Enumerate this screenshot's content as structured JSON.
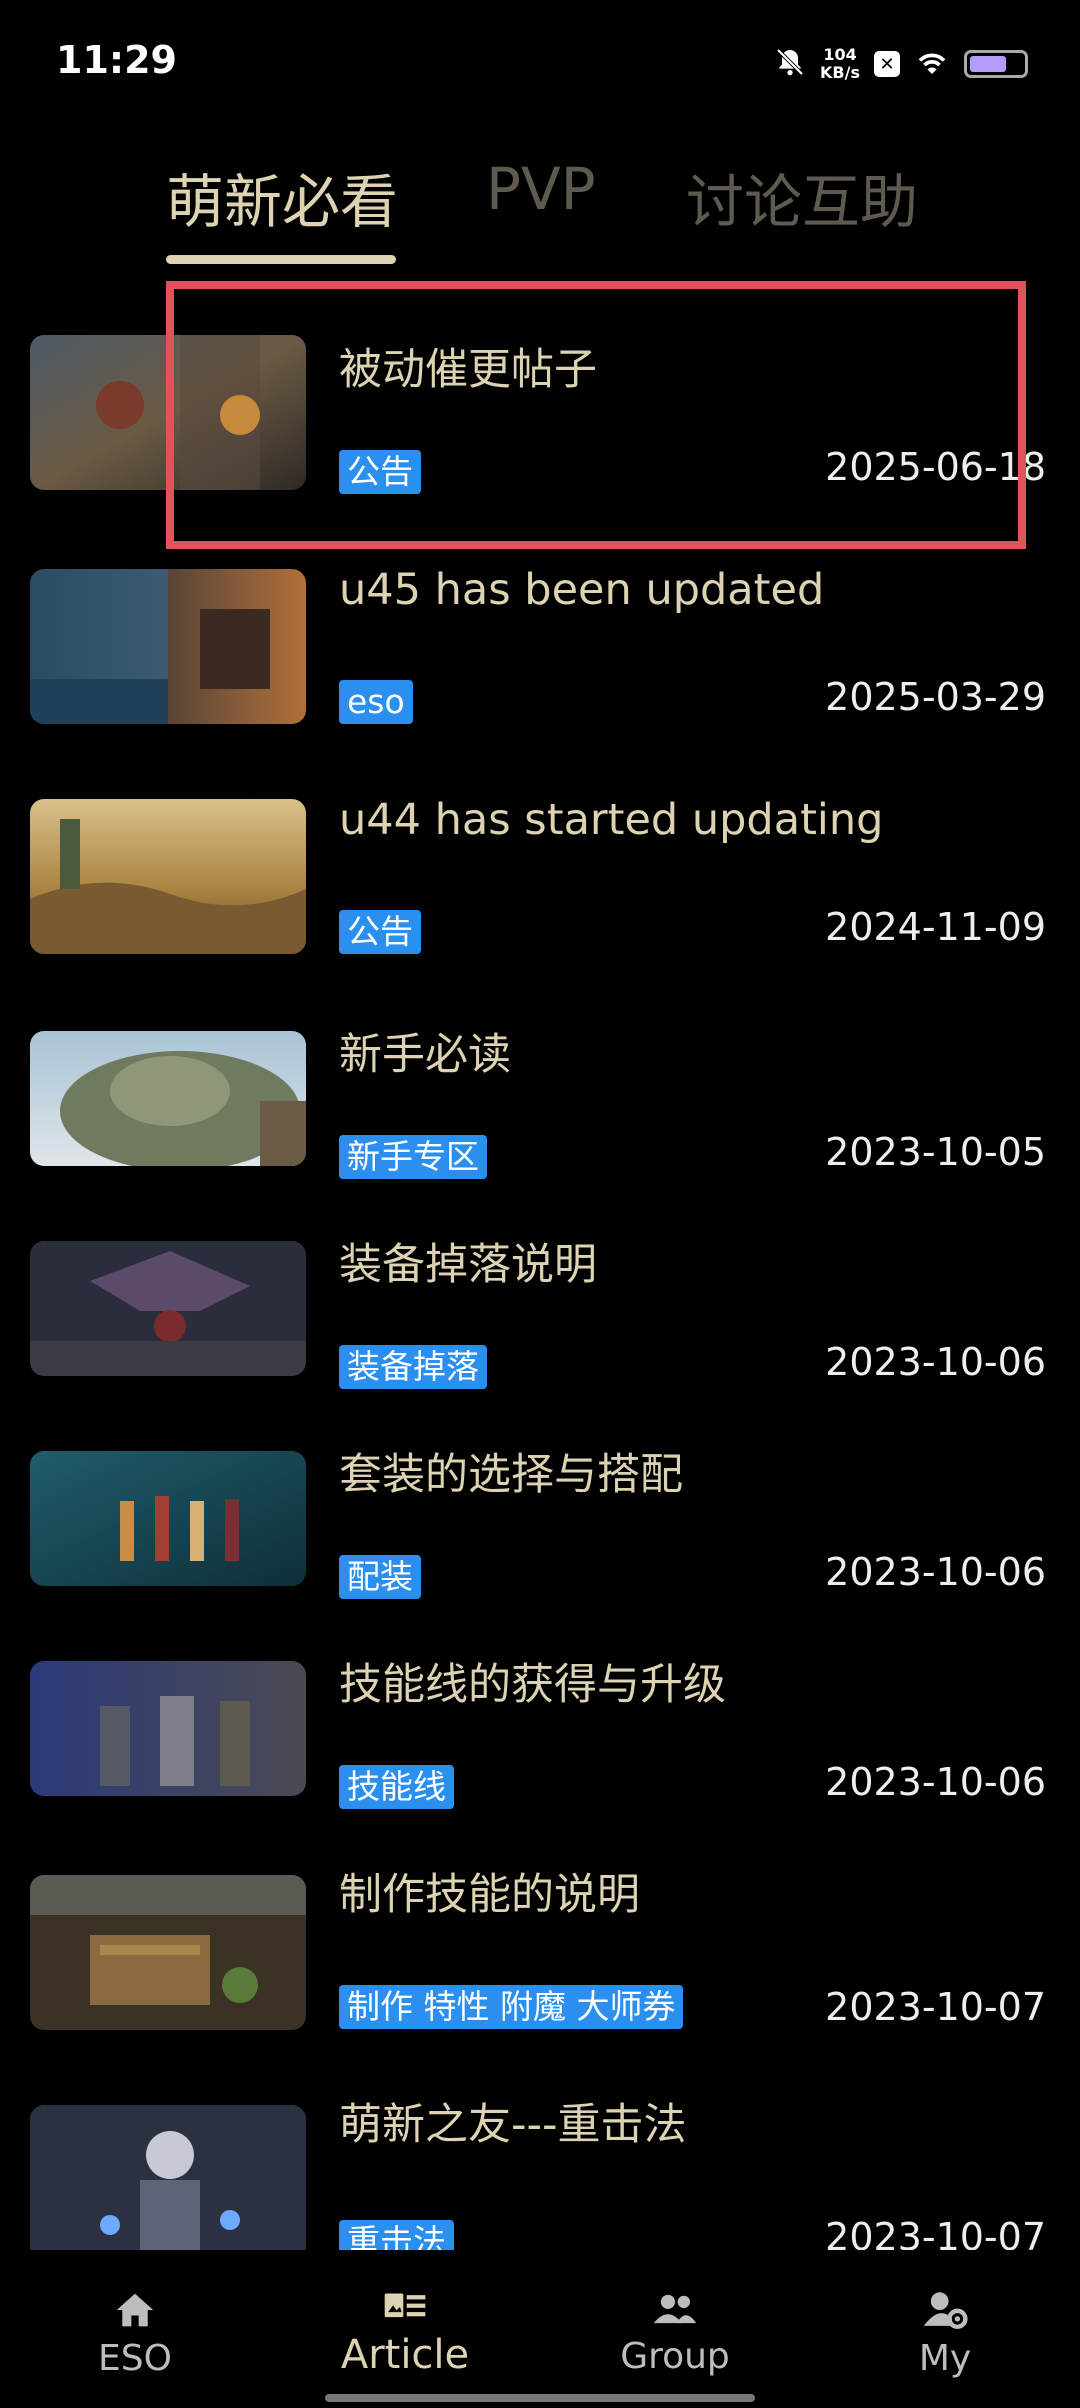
{
  "status": {
    "time": "11:29",
    "speed_value": "104",
    "speed_unit": "KB/s"
  },
  "tabs": [
    {
      "label": "萌新必看"
    },
    {
      "label": "PVP"
    },
    {
      "label": "讨论互助"
    }
  ],
  "posts": [
    {
      "title": "被动催更帖子",
      "tag": "公告",
      "date": "2025-06-18"
    },
    {
      "title": "u45 has been updated",
      "tag": "eso",
      "date": "2025-03-29"
    },
    {
      "title": "u44 has started updating",
      "tag": "公告",
      "date": "2024-11-09"
    },
    {
      "title": " 新手必读",
      "tag": " 新手专区",
      "date": "2023-10-05"
    },
    {
      "title": "装备掉落说明",
      "tag": "装备掉落",
      "date": "2023-10-06"
    },
    {
      "title": "套装的选择与搭配",
      "tag": "配装",
      "date": "2023-10-06"
    },
    {
      "title": "技能线的获得与升级",
      "tag": "技能线",
      "date": "2023-10-06"
    },
    {
      "title": "制作技能的说明",
      "tag": "制作 特性 附魔 大师券",
      "date": "2023-10-07"
    },
    {
      "title": "萌新之友---重击法",
      "tag": "重击法",
      "date": "2023-10-07"
    }
  ],
  "nav": [
    {
      "label": "ESO",
      "icon": "home-icon"
    },
    {
      "label": "Article",
      "icon": "article-icon"
    },
    {
      "label": "Group",
      "icon": "group-icon"
    },
    {
      "label": "My",
      "icon": "user-settings-icon"
    }
  ],
  "colors": {
    "accent": "#ddd3b2",
    "tag": "#2b8ff0",
    "highlight": "#e05459"
  }
}
